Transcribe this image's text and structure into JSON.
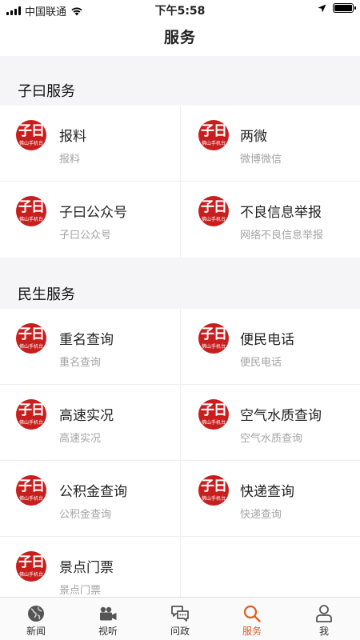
{
  "status_bar": {
    "carrier": "中国联通",
    "time": "下午5:58"
  },
  "nav": {
    "title": "服务"
  },
  "logo": {
    "main": "子日",
    "sub": "佛山手机台"
  },
  "sections": [
    {
      "title": "子曰服务",
      "items": [
        {
          "title": "报料",
          "subtitle": "报料"
        },
        {
          "title": "两微",
          "subtitle": "微博微信"
        },
        {
          "title": "子曰公众号",
          "subtitle": "子曰公众号"
        },
        {
          "title": "不良信息举报",
          "subtitle": "网络不良信息举报"
        }
      ]
    },
    {
      "title": "民生服务",
      "items": [
        {
          "title": "重名查询",
          "subtitle": "重名查询"
        },
        {
          "title": "便民电话",
          "subtitle": "便民电话"
        },
        {
          "title": "高速实况",
          "subtitle": "高速实况"
        },
        {
          "title": "空气水质查询",
          "subtitle": "空气水质查询"
        },
        {
          "title": "公积金查询",
          "subtitle": "公积金查询"
        },
        {
          "title": "快递查询",
          "subtitle": "快递查询"
        },
        {
          "title": "景点门票",
          "subtitle": "景点门票"
        }
      ]
    }
  ],
  "tabs": [
    {
      "label": "新闻",
      "icon": "globe-icon",
      "active": false
    },
    {
      "label": "视听",
      "icon": "video-camera-icon",
      "active": false
    },
    {
      "label": "问政",
      "icon": "chat-bubbles-icon",
      "active": false
    },
    {
      "label": "服务",
      "icon": "search-icon",
      "active": true
    },
    {
      "label": "我",
      "icon": "person-icon",
      "active": false
    }
  ],
  "colors": {
    "accent": "#e25b1f",
    "logo_red": "#c81e1e",
    "background": "#f5f5f7"
  }
}
